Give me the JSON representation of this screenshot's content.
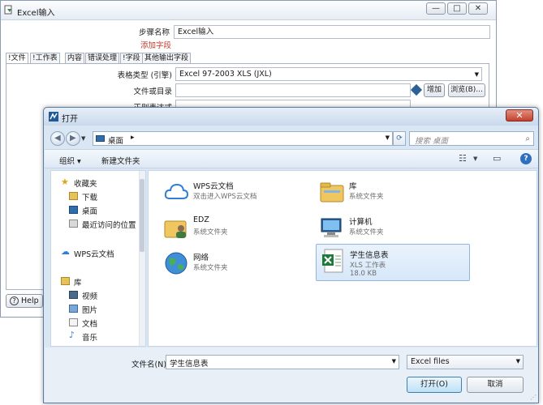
{
  "back_window": {
    "title": "Excel输入",
    "minimize": "—",
    "maximize": "□",
    "close": "✕",
    "step_name_label": "步骤名称",
    "step_name_value": "Excel输入",
    "add_field_link": "添加字段",
    "tabs": [
      {
        "label": "!文件"
      },
      {
        "label": "!工作表"
      },
      {
        "label": "内容"
      },
      {
        "label": "错误处理"
      },
      {
        "label": "!字段"
      },
      {
        "label": "其他输出字段"
      }
    ],
    "table_type_label": "表格类型 (引擎)",
    "table_type_value": "Excel 97-2003 XLS (JXL)",
    "file_or_dir_label": "文件或目录",
    "regex_label": "正则表达式",
    "add_button": "增加",
    "browse_button": "浏览(B)...",
    "help_button": "Help"
  },
  "dialog": {
    "title": "打开",
    "close": "✕",
    "address": "桌面",
    "address_sep": "▸",
    "search_placeholder": "搜索 桌面",
    "toolbar": {
      "organize": "组织 ▾",
      "new_folder": "新建文件夹"
    },
    "sidebar": {
      "favorites_header": "收藏夹",
      "favorites": [
        "下载",
        "桌面",
        "最近访问的位置"
      ],
      "wps": "WPS云文档",
      "library_header": "库",
      "library": [
        "视频",
        "图片",
        "文档",
        "音乐"
      ]
    },
    "files": [
      {
        "name": "WPS云文档",
        "sub": "双击进入WPS云文档",
        "icon": "cloud-icon"
      },
      {
        "name": "库",
        "sub": "系统文件夹",
        "icon": "library-folder-icon"
      },
      {
        "name": "EDZ",
        "sub": "系统文件夹",
        "icon": "user-folder-icon"
      },
      {
        "name": "计算机",
        "sub": "系统文件夹",
        "icon": "computer-icon"
      },
      {
        "name": "网络",
        "sub": "系统文件夹",
        "icon": "network-globe-icon"
      },
      {
        "name": "学生信息表",
        "sub": "XLS 工作表",
        "sub2": "18.0 KB",
        "icon": "excel-file-icon",
        "selected": true
      }
    ],
    "filename_label": "文件名(N):",
    "filename_value": "学生信息表",
    "filetype_value": "Excel files",
    "open_button": "打开(O)",
    "cancel_button": "取消"
  },
  "colors": {
    "dialog_frame": "#5b7ca5",
    "close_red": "#c4402d",
    "selection_blue": "#d6e7f9",
    "link_red": "#c0392b"
  }
}
